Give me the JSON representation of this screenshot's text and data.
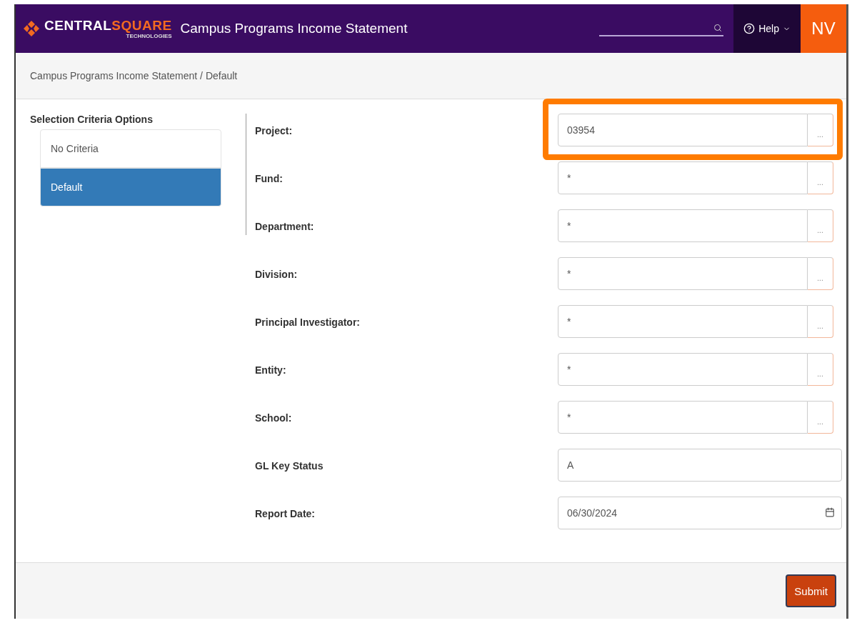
{
  "header": {
    "logo": {
      "primary": "CENTRAL",
      "accent": "SQUARE",
      "tagline": "TECHNOLOGIES"
    },
    "title": "Campus Programs Income Statement",
    "help": "Help",
    "user_initials": "NV"
  },
  "breadcrumb": "Campus Programs Income Statement / Default",
  "sidebar": {
    "title": "Selection Criteria Options",
    "items": [
      {
        "label": "No Criteria",
        "selected": false
      },
      {
        "label": "Default",
        "selected": true
      }
    ]
  },
  "fields": [
    {
      "label": "Project:",
      "kind": "lookup",
      "value": "03954",
      "lookup_label": "...",
      "highlighted": true
    },
    {
      "label": "Fund:",
      "kind": "lookup",
      "value": "*",
      "lookup_label": "...",
      "highlighted": false
    },
    {
      "label": "Department:",
      "kind": "lookup",
      "value": "*",
      "lookup_label": "...",
      "highlighted": false
    },
    {
      "label": "Division:",
      "kind": "lookup",
      "value": "*",
      "lookup_label": "...",
      "highlighted": false
    },
    {
      "label": "Principal Investigator:",
      "kind": "lookup",
      "value": "*",
      "lookup_label": "...",
      "highlighted": false
    },
    {
      "label": "Entity:",
      "kind": "lookup",
      "value": "*",
      "lookup_label": "...",
      "highlighted": false
    },
    {
      "label": "School:",
      "kind": "lookup",
      "value": "*",
      "lookup_label": "...",
      "highlighted": false
    },
    {
      "label": "GL Key Status",
      "kind": "text",
      "value": "A",
      "highlighted": false
    },
    {
      "label": "Report Date:",
      "kind": "date",
      "value": "06/30/2024",
      "highlighted": false
    }
  ],
  "submit": "Submit"
}
